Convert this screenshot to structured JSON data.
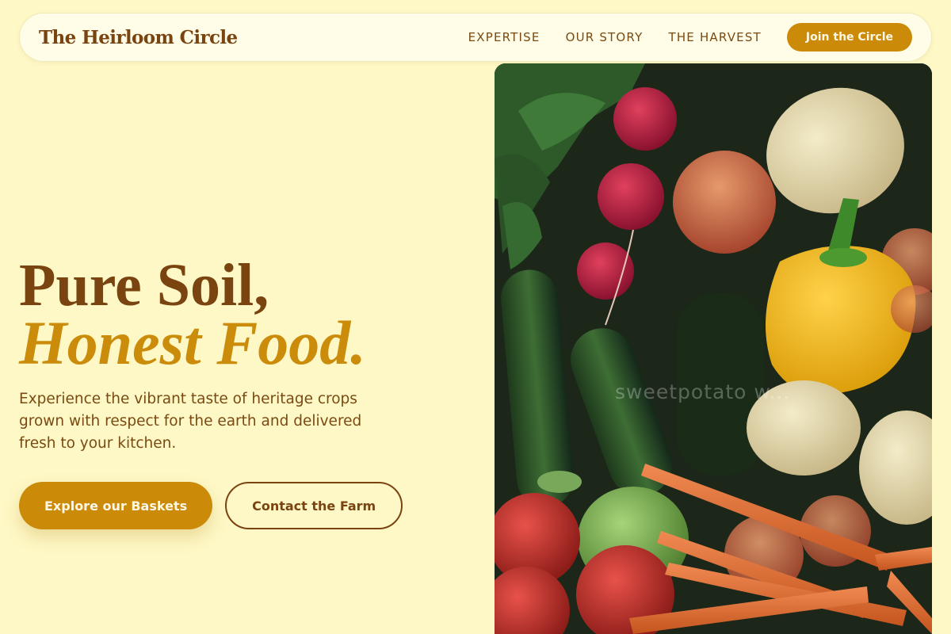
{
  "brand": {
    "name": "The Heirloom Circle"
  },
  "nav": {
    "links": [
      "EXPERTISE",
      "OUR STORY",
      "THE HARVEST"
    ],
    "cta": "Join the Circle"
  },
  "hero": {
    "line1": "Pure Soil,",
    "line2": "Honest Food.",
    "description": "Experience the vibrant taste of heritage crops grown with respect for the earth and delivered fresh to your kitchen.",
    "primary_button": "Explore our Baskets",
    "secondary_button": "Contact the Farm"
  },
  "image": {
    "subject": "fresh vegetables photo",
    "watermark": "sweetpotato w..."
  },
  "colors": {
    "background": "#fef8c6",
    "accent": "#cb8a08",
    "text_brown": "#7a4411"
  }
}
